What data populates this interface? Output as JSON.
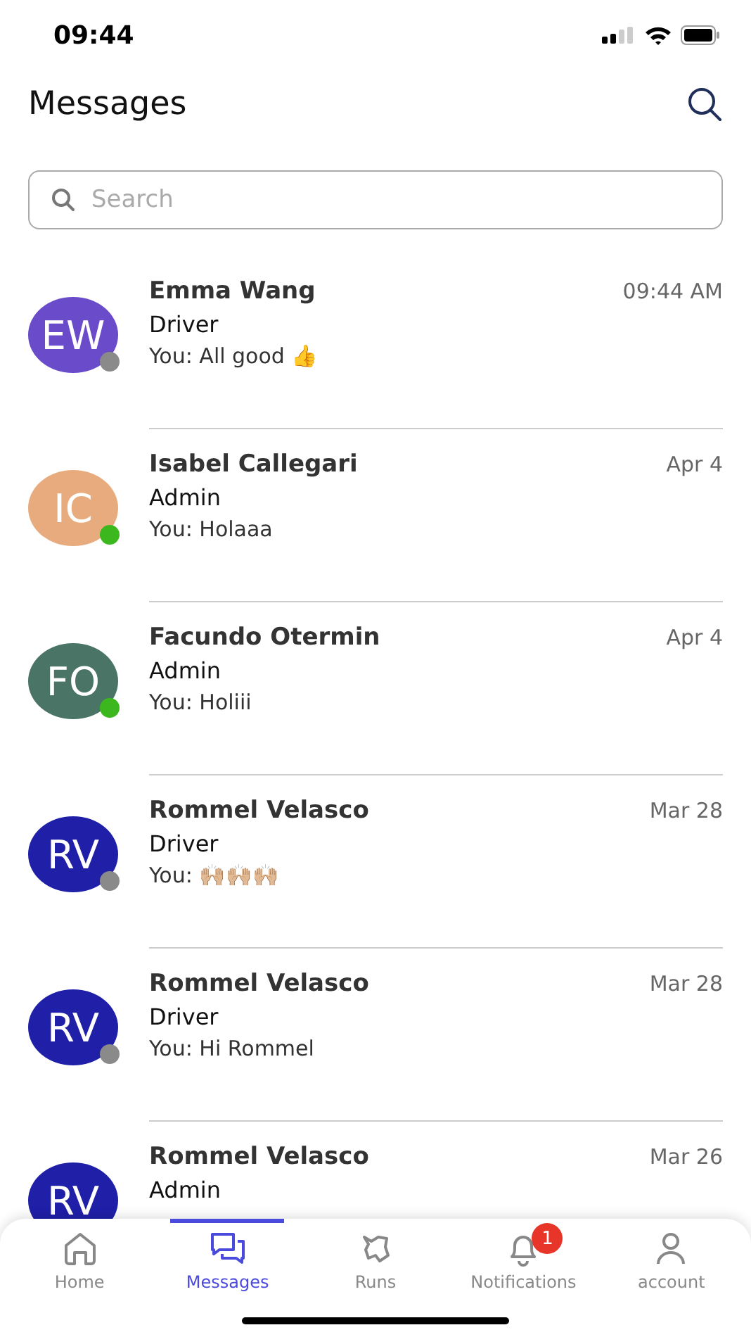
{
  "status_bar": {
    "time": "09:44"
  },
  "header": {
    "title": "Messages"
  },
  "search": {
    "placeholder": "Search"
  },
  "conversations": [
    {
      "initials": "EW",
      "color": "#6a4bc9",
      "online": false,
      "name": "Emma Wang",
      "role": "Driver",
      "preview": "You: All good 👍",
      "time": "09:44 AM"
    },
    {
      "initials": "IC",
      "color": "#e8ab7e",
      "online": true,
      "name": "Isabel Callegari",
      "role": "Admin",
      "preview": "You: Holaaa",
      "time": "Apr 4"
    },
    {
      "initials": "FO",
      "color": "#4a7466",
      "online": true,
      "name": "Facundo Otermin",
      "role": "Admin",
      "preview": "You: Holiii",
      "time": "Apr 4"
    },
    {
      "initials": "RV",
      "color": "#1f1fa8",
      "online": false,
      "name": "Rommel Velasco",
      "role": "Driver",
      "preview": "You: 🙌🏼🙌🏼🙌🏼",
      "time": "Mar 28"
    },
    {
      "initials": "RV",
      "color": "#1f1fa8",
      "online": false,
      "name": "Rommel Velasco",
      "role": "Driver",
      "preview": "You: Hi Rommel",
      "time": "Mar 28"
    },
    {
      "initials": "RV",
      "color": "#1f1fa8",
      "name": "Rommel Velasco",
      "role": "Admin",
      "time": "Mar 26"
    }
  ],
  "tabs": [
    {
      "kind": "home",
      "label": "Home",
      "selected": false
    },
    {
      "kind": "messages",
      "label": "Messages",
      "selected": true
    },
    {
      "kind": "runs",
      "label": "Runs",
      "selected": false
    },
    {
      "kind": "bell",
      "label": "Notifications",
      "selected": false,
      "badge": "1"
    },
    {
      "kind": "person",
      "label": "account",
      "selected": false
    }
  ]
}
